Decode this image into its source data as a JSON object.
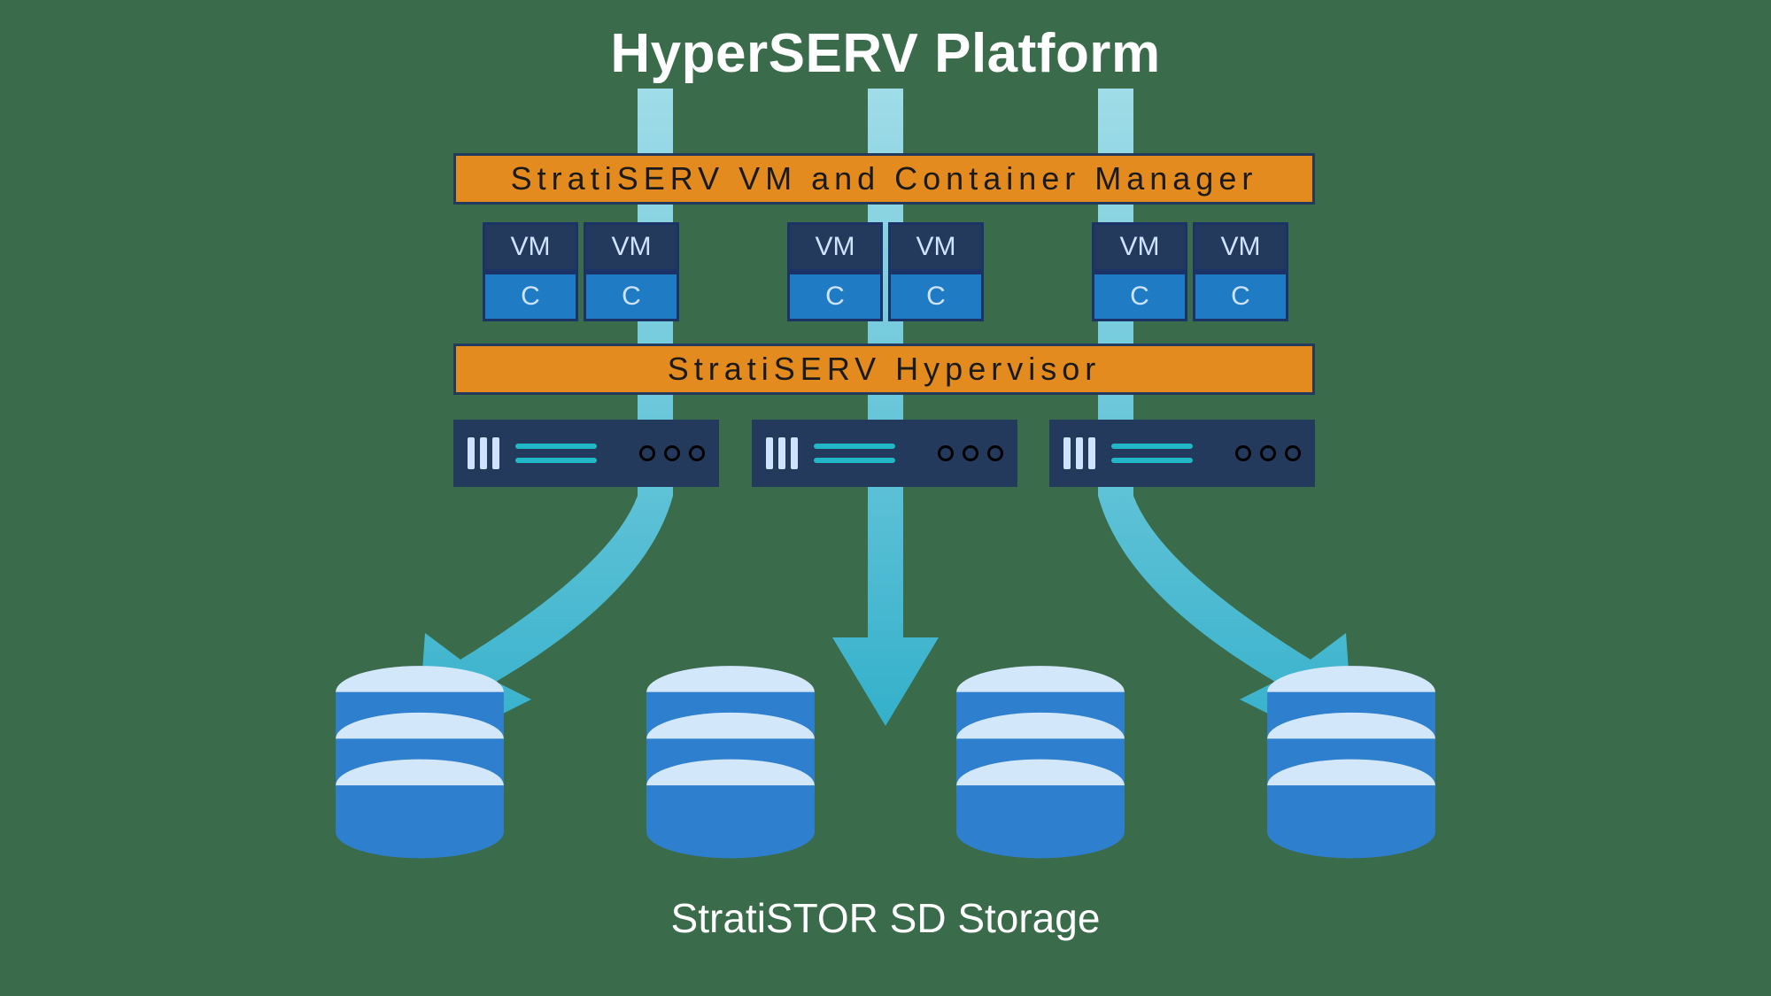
{
  "title": "HyperSERV Platform",
  "layers": {
    "manager": "StratiSERV VM and Container Manager",
    "hypervisor": "StratiSERV Hypervisor"
  },
  "vm_row": {
    "groups": 3,
    "pairs_per_group": 2,
    "top_label": "VM",
    "bottom_label": "C"
  },
  "servers": {
    "count": 3
  },
  "arrows": {
    "count": 3
  },
  "storage": {
    "label": "StratiSTOR SD Storage",
    "cylinders": 4
  },
  "colors": {
    "bg": "#3a6b4a",
    "orange": "#e38b1e",
    "navy": "#233a5c",
    "blue": "#1f7cc4",
    "arrow_light": "#7fd6ef",
    "arrow_dark": "#33b6d6",
    "db_light": "#d3e7fb",
    "db_mid": "#5ea4e8",
    "db_dark": "#2f7fcf"
  }
}
